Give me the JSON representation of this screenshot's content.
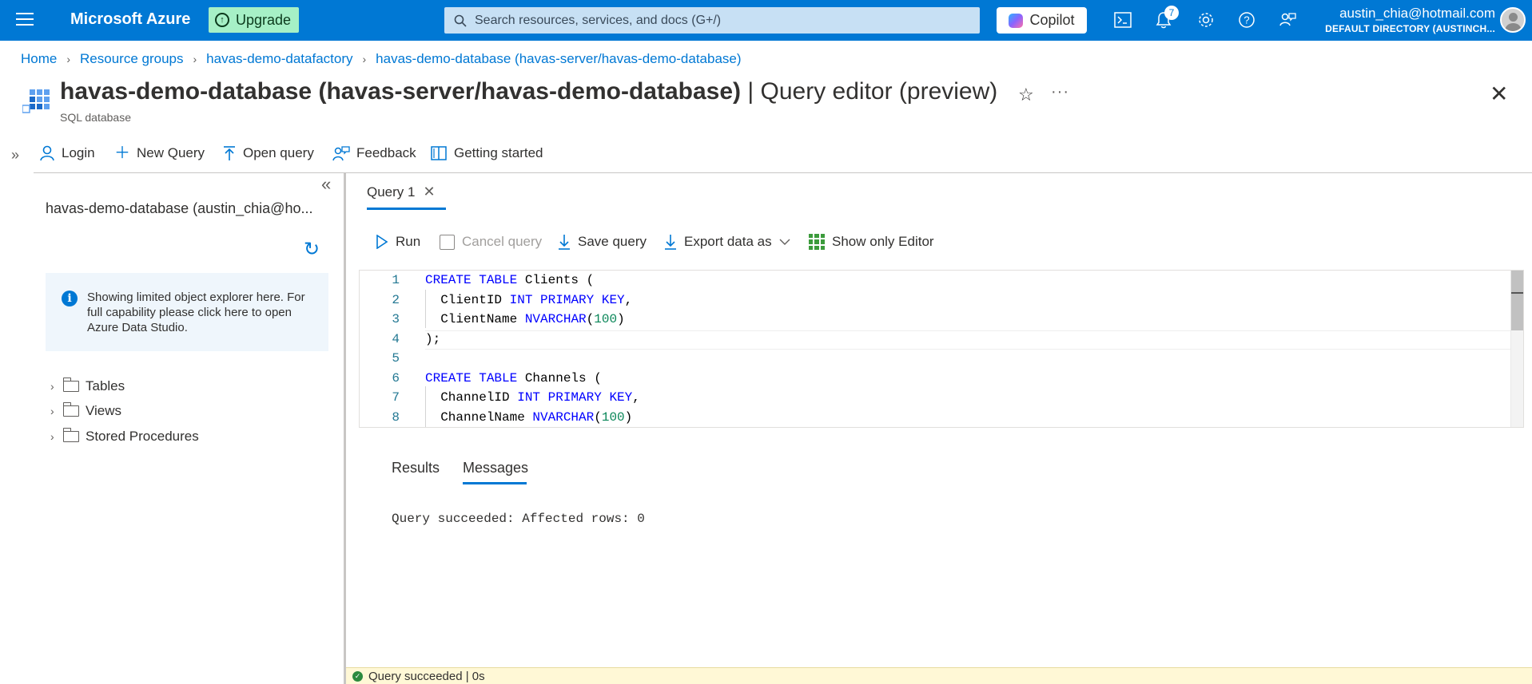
{
  "topbar": {
    "brand": "Microsoft Azure",
    "upgrade_label": "Upgrade",
    "search_placeholder": "Search resources, services, and docs (G+/)",
    "copilot_label": "Copilot",
    "notification_count": "7",
    "user_email": "austin_chia@hotmail.com",
    "user_directory": "DEFAULT DIRECTORY (AUSTINCH...",
    "icons": [
      "menu-icon",
      "cloud-shell-icon",
      "bell-icon",
      "gear-icon",
      "help-icon",
      "feedback-icon"
    ]
  },
  "breadcrumb": {
    "items": [
      "Home",
      "Resource groups",
      "havas-demo-datafactory",
      "havas-demo-database (havas-server/havas-demo-database)"
    ]
  },
  "header": {
    "resource_name": "havas-demo-database (havas-server/havas-demo-database)",
    "separator": " | ",
    "blade_name": "Query editor (preview)",
    "subtitle": "SQL database"
  },
  "commands": {
    "login": "Login",
    "new_query": "New Query",
    "open_query": "Open query",
    "feedback": "Feedback",
    "getting_started": "Getting started"
  },
  "explorer": {
    "db_label": "havas-demo-database (austin_chia@ho...",
    "info_text": "Showing limited object explorer here. For full capability please click here to open Azure Data Studio.",
    "tree": [
      "Tables",
      "Views",
      "Stored Procedures"
    ]
  },
  "editor": {
    "tab_label": "Query 1",
    "toolbar": {
      "run": "Run",
      "cancel_query": "Cancel query",
      "save_query": "Save query",
      "export_data_as": "Export data as",
      "show_only_editor": "Show only Editor"
    },
    "lines": [
      {
        "n": "1",
        "segments": [
          {
            "t": "CREATE TABLE",
            "c": "kw"
          },
          {
            "t": " Clients (",
            "c": ""
          }
        ]
      },
      {
        "n": "2",
        "segments": [
          {
            "t": "  ClientID ",
            "c": ""
          },
          {
            "t": "INT PRIMARY KEY",
            "c": "kw"
          },
          {
            "t": ",",
            "c": ""
          }
        ]
      },
      {
        "n": "3",
        "segments": [
          {
            "t": "  ClientName ",
            "c": ""
          },
          {
            "t": "NVARCHAR",
            "c": "kw"
          },
          {
            "t": "(",
            "c": ""
          },
          {
            "t": "100",
            "c": "num"
          },
          {
            "t": ")",
            "c": ""
          }
        ]
      },
      {
        "n": "4",
        "segments": [
          {
            "t": ");",
            "c": ""
          }
        ]
      },
      {
        "n": "5",
        "segments": []
      },
      {
        "n": "6",
        "segments": [
          {
            "t": "CREATE TABLE",
            "c": "kw"
          },
          {
            "t": " Channels (",
            "c": ""
          }
        ]
      },
      {
        "n": "7",
        "segments": [
          {
            "t": "  ChannelID ",
            "c": ""
          },
          {
            "t": "INT PRIMARY KEY",
            "c": "kw"
          },
          {
            "t": ",",
            "c": ""
          }
        ]
      },
      {
        "n": "8",
        "segments": [
          {
            "t": "  ChannelName ",
            "c": ""
          },
          {
            "t": "NVARCHAR",
            "c": "kw"
          },
          {
            "t": "(",
            "c": ""
          },
          {
            "t": "100",
            "c": "num"
          },
          {
            "t": ")",
            "c": ""
          }
        ]
      }
    ]
  },
  "results": {
    "tabs": [
      "Results",
      "Messages"
    ],
    "active_tab": "Messages",
    "message": "Query succeeded: Affected rows: 0"
  },
  "status": {
    "text": "Query succeeded | 0s"
  },
  "colors": {
    "accent": "#0078d4",
    "upgrade": "#a6f0c6",
    "status_bg": "#fff8d6",
    "success": "#2b8a3e"
  }
}
